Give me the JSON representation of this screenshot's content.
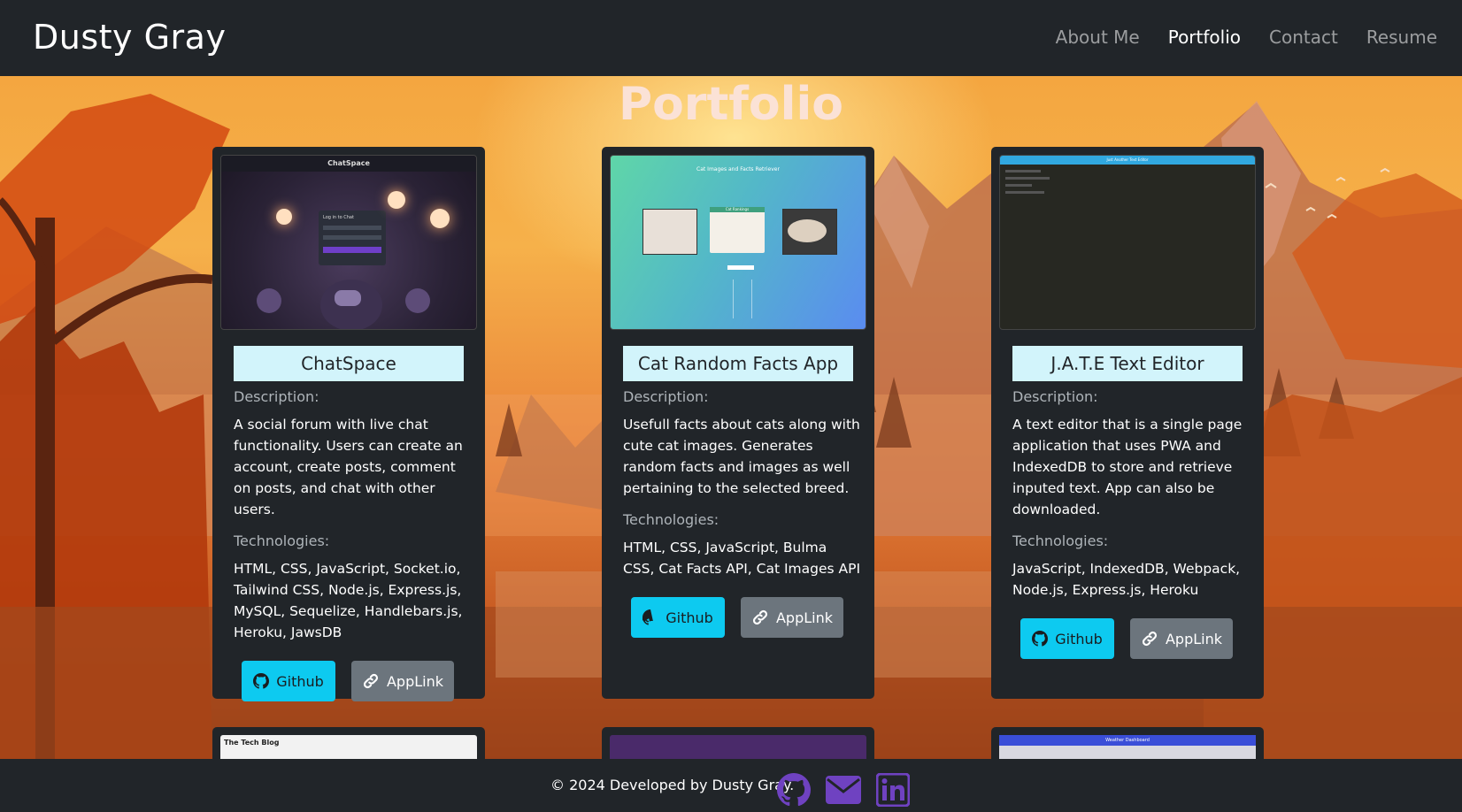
{
  "nav": {
    "brand": "Dusty Gray",
    "links": [
      "About Me",
      "Portfolio",
      "Contact",
      "Resume"
    ]
  },
  "page": {
    "title": "Portfolio"
  },
  "projects": [
    {
      "title": "ChatSpace",
      "description_label": "Description:",
      "description": "A social forum with live chat functionality. Users can create an account, create posts, comment on posts, and chat with other users.",
      "tech_label": "Technologies:",
      "technologies": "HTML, CSS, JavaScript, Socket.io, Tailwind CSS, Node.js, Express.js, MySQL, Sequelize, Handlebars.js, Heroku, JawsDB",
      "github_label": "Github",
      "app_label": "AppLink",
      "thumb_header": "ChatSpace",
      "thumb_login": "Log in to Chat"
    },
    {
      "title": "Cat Random Facts App",
      "description_label": "Description:",
      "description": "Usefull facts about cats along with cute cat images. Generates random facts and images as well pertaining to the selected breed.",
      "tech_label": "Technologies:",
      "technologies": "HTML, CSS, JavaScript, Bulma CSS, Cat Facts API, Cat Images API",
      "github_label": "Github",
      "app_label": "AppLink",
      "thumb_header": "Cat Images and Facts Retriever",
      "thumb_sub": "Cat Rankings"
    },
    {
      "title": "J.A.T.E Text Editor",
      "description_label": "Description:",
      "description": "A text editor that is a single page application that uses PWA and IndexedDB to store and retrieve inputed text. App can also be downloaded.",
      "tech_label": "Technologies:",
      "technologies": "JavaScript, IndexedDB, Webpack, Node.js, Express.js, Heroku",
      "github_label": "Github",
      "app_label": "AppLink",
      "thumb_header": "Just Another Text Editor"
    }
  ],
  "partial_cards": [
    {
      "thumb_header": "The Tech Blog"
    },
    {
      "thumb_header": ""
    },
    {
      "thumb_header": "Weather Dashboard"
    }
  ],
  "footer": {
    "text": "© 2024 Developed by Dusty Gray.",
    "icons": [
      "github-icon",
      "email-icon",
      "linkedin-icon"
    ],
    "icon_color": "#6f42c1"
  },
  "colors": {
    "accent": "#0dcaf0",
    "secondary": "#6c757d",
    "title_bg": "#d2f4fb",
    "dark": "#212529"
  }
}
